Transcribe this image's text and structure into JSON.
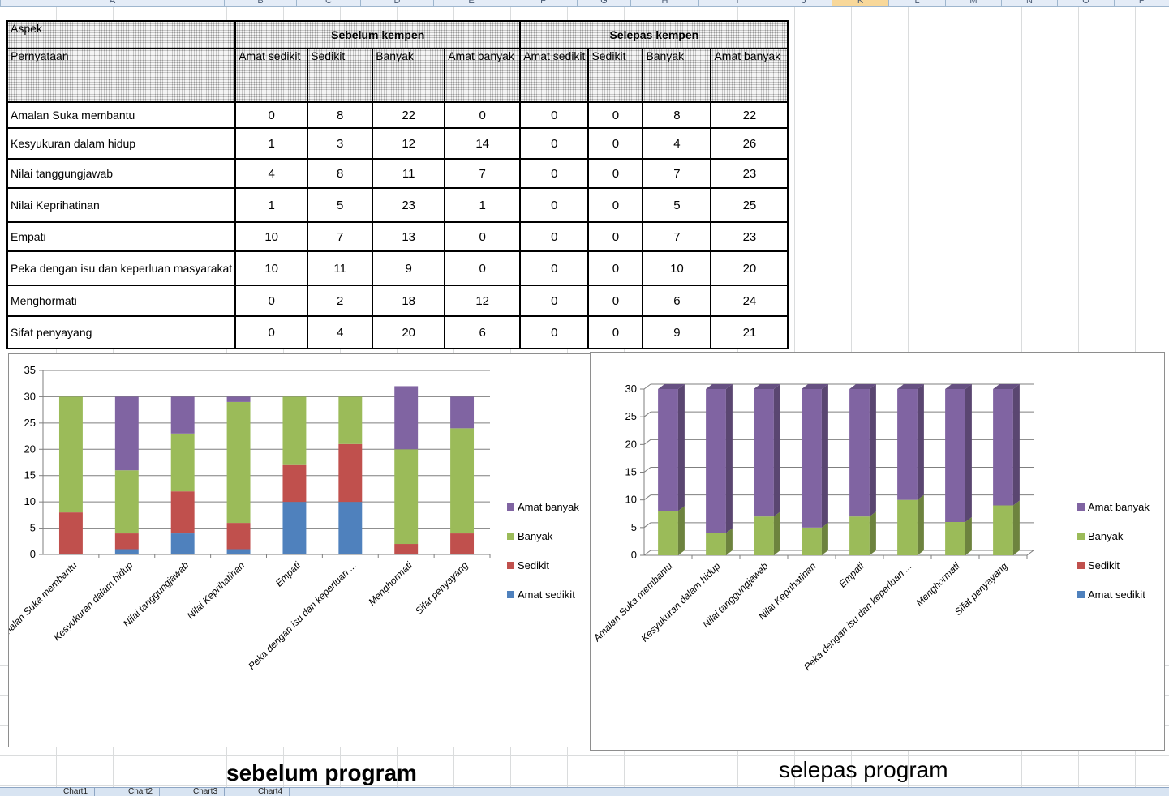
{
  "column_headers": [
    "A",
    "B",
    "C",
    "D",
    "E",
    "F",
    "G",
    "H",
    "I",
    "J",
    "K",
    "L",
    "M",
    "N",
    "O",
    "P"
  ],
  "selected_column": "K",
  "table": {
    "aspect_label": "Aspek",
    "before_label": "Sebelum kempen",
    "after_label": "Selepas kempen",
    "statement_label": "Pernyataan",
    "levels": [
      "Amat sedikit",
      "Sedikit",
      "Banyak",
      "Amat banyak",
      "Amat sedikit",
      "Sedikit",
      "Banyak",
      "Amat banyak"
    ],
    "rows": [
      {
        "label": "Amalan Suka membantu",
        "values": [
          "0",
          "8",
          "22",
          "0",
          "0",
          "0",
          "8",
          "22"
        ]
      },
      {
        "label": "Kesyukuran dalam hidup",
        "values": [
          "1",
          "3",
          "12",
          "14",
          "0",
          "0",
          "4",
          "26"
        ]
      },
      {
        "label": "Nilai tanggungjawab",
        "values": [
          "4",
          "8",
          "11",
          "7",
          "0",
          "0",
          "7",
          "23"
        ]
      },
      {
        "label": "Nilai Keprihatinan",
        "values": [
          "1",
          "5",
          "23",
          "1",
          "0",
          "0",
          "5",
          "25"
        ]
      },
      {
        "label": "Empati",
        "values": [
          "10",
          "7",
          "13",
          "0",
          "0",
          "0",
          "7",
          "23"
        ]
      },
      {
        "label": "Peka dengan isu dan keperluan masyarakat",
        "values": [
          "10",
          "11",
          "9",
          "0",
          "0",
          "0",
          "10",
          "20"
        ]
      },
      {
        "label": "Menghormati",
        "values": [
          "0",
          "2",
          "18",
          "12",
          "0",
          "0",
          "6",
          "24"
        ]
      },
      {
        "label": "Sifat penyayang",
        "values": [
          "0",
          "4",
          "20",
          "6",
          "0",
          "0",
          "9",
          "21"
        ]
      }
    ]
  },
  "colors": {
    "amat_sedikit": "#4f81bd",
    "sedikit": "#c0504d",
    "banyak": "#9bbb59",
    "amat_banyak": "#8064a2"
  },
  "chart_data": [
    {
      "type": "bar",
      "stacked": true,
      "categories": [
        "Amalan Suka membantu",
        "Kesyukuran dalam hidup",
        "Nilai tanggungjawab",
        "Nilai Keprihatinan",
        "Empati",
        "Peka dengan isu dan keperluan ...",
        "Menghormati",
        "Sifat penyayang"
      ],
      "series": [
        {
          "name": "Amat sedikit",
          "values": [
            0,
            1,
            4,
            1,
            10,
            10,
            0,
            0
          ]
        },
        {
          "name": "Sedikit",
          "values": [
            8,
            3,
            8,
            5,
            7,
            11,
            2,
            4
          ]
        },
        {
          "name": "Banyak",
          "values": [
            22,
            12,
            11,
            23,
            13,
            9,
            18,
            20
          ]
        },
        {
          "name": "Amat banyak",
          "values": [
            0,
            14,
            7,
            1,
            0,
            0,
            12,
            6
          ]
        }
      ],
      "ylim": [
        0,
        35
      ],
      "yticks": [
        "0",
        "5",
        "10",
        "15",
        "20",
        "25",
        "30",
        "35"
      ],
      "grid": true,
      "legend": "right",
      "title": "",
      "xlabel": "",
      "ylabel": ""
    },
    {
      "type": "bar",
      "stacked": true,
      "style": "3d",
      "categories": [
        "Amalan Suka membantu",
        "Kesyukuran dalam hidup",
        "Nilai tanggungjawab",
        "Nilai Keprihatinan",
        "Empati",
        "Peka dengan isu dan keperluan ...",
        "Menghormati",
        "Sifat penyayang"
      ],
      "series": [
        {
          "name": "Amat sedikit",
          "values": [
            0,
            0,
            0,
            0,
            0,
            0,
            0,
            0
          ]
        },
        {
          "name": "Sedikit",
          "values": [
            0,
            0,
            0,
            0,
            0,
            0,
            0,
            0
          ]
        },
        {
          "name": "Banyak",
          "values": [
            8,
            4,
            7,
            5,
            7,
            10,
            6,
            9
          ]
        },
        {
          "name": "Amat banyak",
          "values": [
            22,
            26,
            23,
            25,
            23,
            20,
            24,
            21
          ]
        }
      ],
      "ylim": [
        0,
        30
      ],
      "yticks": [
        "0",
        "5",
        "10",
        "15",
        "20",
        "25",
        "30"
      ],
      "grid": true,
      "legend": "right",
      "title": "",
      "xlabel": "",
      "ylabel": ""
    }
  ],
  "legend_items": [
    "Amat banyak",
    "Banyak",
    "Sedikit",
    "Amat sedikit"
  ],
  "captions": {
    "left": "sebelum program",
    "right": "selepas program"
  },
  "sheet_tabs": [
    "Chart1",
    "Chart2",
    "Chart3",
    "Chart4"
  ]
}
